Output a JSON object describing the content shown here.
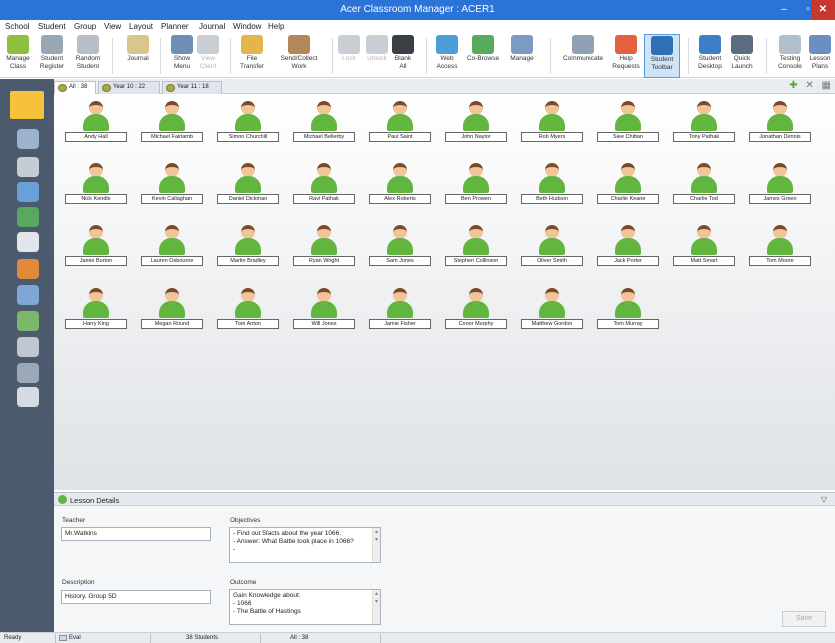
{
  "window": {
    "title": "Acer Classroom Manager : ACER1",
    "minimize": "–",
    "maximize": "▫",
    "close": "✕"
  },
  "menu": [
    "School",
    "Student",
    "Group",
    "View",
    "Layout",
    "Planner",
    "Journal",
    "Window",
    "Help"
  ],
  "ribbon": [
    {
      "label": "Manage\nClass",
      "icon": "manage-class-icon",
      "color": "#8fbf3f"
    },
    {
      "label": "Student\nRegister",
      "icon": "student-register-icon",
      "color": "#9aa7b5"
    },
    {
      "label": "Random\nStudent",
      "icon": "random-student-icon",
      "color": "#b7bec7"
    },
    {
      "label": "Journal",
      "icon": "journal-icon",
      "color": "#d9c68c"
    },
    {
      "label": "Show\nMenu",
      "icon": "show-icon",
      "color": "#6f8fb8"
    },
    {
      "label": "View\nClient",
      "icon": "view-client-icon",
      "color": "#c9ced4",
      "disabled": true
    },
    {
      "label": "File\nTransfer",
      "icon": "file-transfer-icon",
      "color": "#e2b64a"
    },
    {
      "label": "Send/Collect\nWork",
      "icon": "send-collect-icon",
      "color": "#b4875a"
    },
    {
      "label": "Lock",
      "icon": "lock-icon",
      "color": "#c9ced4",
      "disabled": true
    },
    {
      "label": "Unlock",
      "icon": "unlock-icon",
      "color": "#c9ced4",
      "disabled": true
    },
    {
      "label": "Blank\nAll",
      "icon": "blank-all-icon",
      "color": "#3b3f45"
    },
    {
      "label": "Web\nAccess",
      "icon": "web-access-icon",
      "color": "#4d9ed8"
    },
    {
      "label": "Co-Browse",
      "icon": "co-browse-icon",
      "color": "#58ab5e"
    },
    {
      "label": "Manage",
      "icon": "manage-icon",
      "color": "#7a9cc4"
    },
    {
      "label": "Communicate",
      "icon": "communicate-icon",
      "color": "#8fa1b3"
    },
    {
      "label": "Help\nRequests",
      "icon": "help-requests-icon",
      "color": "#e5603f"
    },
    {
      "label": "Student\nToolbar",
      "icon": "student-toolbar-icon",
      "color": "#2f6fb5",
      "active": true
    },
    {
      "label": "Student\nDesktop",
      "icon": "student-desktop-icon",
      "color": "#3c7fc8"
    },
    {
      "label": "Quick\nLaunch",
      "icon": "quick-launch-icon",
      "color": "#5d6d80"
    },
    {
      "label": "Testing\nConsole",
      "icon": "testing-console-icon",
      "color": "#b2bfcc"
    },
    {
      "label": "Lesson\nPlans",
      "icon": "lesson-plans-icon",
      "color": "#6a8fc0"
    }
  ],
  "tabs": [
    {
      "label": "All : 38",
      "active": true
    },
    {
      "label": "Year 10 : 22",
      "active": false
    },
    {
      "label": "Year 11 : 18",
      "active": false
    }
  ],
  "tab_tools": {
    "add": "✚",
    "close": "✕",
    "grid": "▦"
  },
  "sidebar": [
    {
      "icon": "home-icon",
      "color": "#f6c23c"
    },
    {
      "icon": "thumbnail-view-icon",
      "color": "#9db4cf"
    },
    {
      "icon": "audio-icon",
      "color": "#c6ccd4"
    },
    {
      "icon": "policy-icon",
      "color": "#6aa0d8"
    },
    {
      "icon": "web-icon",
      "color": "#5aa85e"
    },
    {
      "icon": "application-icon",
      "color": "#e2e6ea"
    },
    {
      "icon": "pie-chart-icon",
      "color": "#e08a3a"
    },
    {
      "icon": "printer-icon",
      "color": "#7fa7d6"
    },
    {
      "icon": "devices-icon",
      "color": "#7db86a"
    },
    {
      "icon": "keystroke-icon",
      "color": "#bfc6ce"
    },
    {
      "icon": "usb-icon",
      "color": "#9aa8b8"
    },
    {
      "icon": "monitor-graph-icon",
      "color": "#d4dbe3"
    }
  ],
  "students": [
    [
      "Andy Hall",
      "Michael Fairlamb",
      "Simon Churchill",
      "Michael Bellerby",
      "Paul Saint",
      "John Naylor",
      "Rob Myers",
      "Siee Chittan",
      "Tony Pathak",
      "Jonathan Dennis"
    ],
    [
      "Nick Kendle",
      "Kevin Callaghan",
      "Daniel Dickman",
      "Ravi Pathak",
      "Alex Roberts",
      "Ben Prowen",
      "Beth Hudson",
      "Charlie Keane",
      "Charlie Tod",
      "James Green"
    ],
    [
      "Jamie Burton",
      "Lauren Osbourne",
      "Martin Bradley",
      "Ryan Wright",
      "Sam Jones",
      "Stephen Collinson",
      "Oliver Smith",
      "Jack Porter",
      "Matt Smart",
      "Tom Moore"
    ],
    [
      "Harry King",
      "Megan Round",
      "Tom Anton",
      "Will Jones",
      "Jamie Fisher",
      "Conor Murphy",
      "Matthew Gordon",
      "Tom Murray"
    ]
  ],
  "lesson": {
    "header": "Lesson Details",
    "collapse": "▽",
    "teacher_label": "Teacher",
    "teacher_value": "Mr.Watkins",
    "description_label": "Description",
    "description_value": "History. Group 5D",
    "objectives_label": "Objectives",
    "objectives_lines": [
      "- Find out 5facts about the year 1066.",
      "- Answer: What Battle took place in 1066?",
      "-"
    ],
    "outcome_label": "Outcome",
    "outcome_lines": [
      "Gain Knowledge about:",
      "- 1066",
      "- The Battle of Hastings"
    ],
    "save_label": "Save"
  },
  "status": {
    "ready": "Ready",
    "eval": "Eval",
    "students": "38 Students",
    "all": "All : 38"
  }
}
